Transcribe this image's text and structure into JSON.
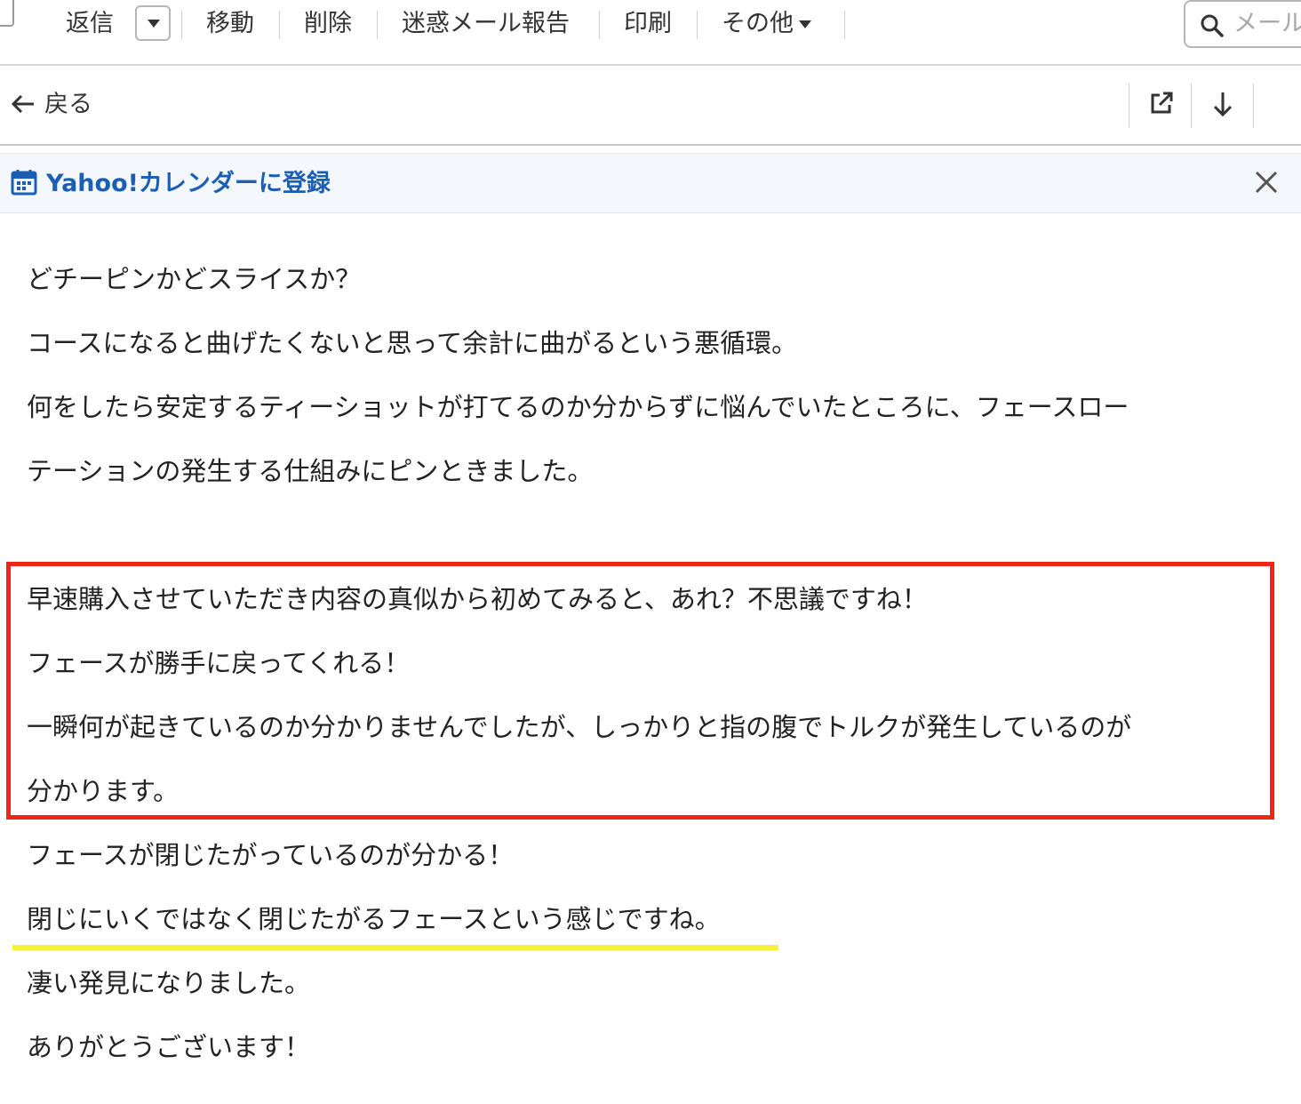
{
  "toolbar": {
    "reply": "返信",
    "move": "移動",
    "delete": "削除",
    "spam_report": "迷惑メール報告",
    "print": "印刷",
    "more": "その他",
    "search_placeholder": "メール"
  },
  "nav": {
    "back": "戻る"
  },
  "calendar_banner": {
    "label": "Yahoo!カレンダーに登録"
  },
  "message": {
    "lines": [
      "どチーピンかどスライスか？",
      "コースになると曲げたくないと思って余計に曲がるという悪循環。",
      "何をしたら安定するティーショットが打てるのか分からずに悩んでいたところに、フェースロー",
      "テーションの発生する仕組みにピンときました。",
      "早速購入させていただき内容の真似から初めてみると、あれ？不思議ですね！",
      "フェースが勝手に戻ってくれる！",
      "一瞬何が起きているのか分かりませんでしたが、しっかりと指の腹でトルクが発生しているのが",
      "分かります。",
      "フェースが閉じたがっているのが分かる！",
      "閉じにいくではなく閉じたがるフェースという感じですね。",
      "凄い発見になりました。",
      "ありがとうございます！"
    ]
  },
  "colors": {
    "highlight_box": "#f02418",
    "underline": "#f8f13a",
    "link": "#1a5fb4"
  }
}
